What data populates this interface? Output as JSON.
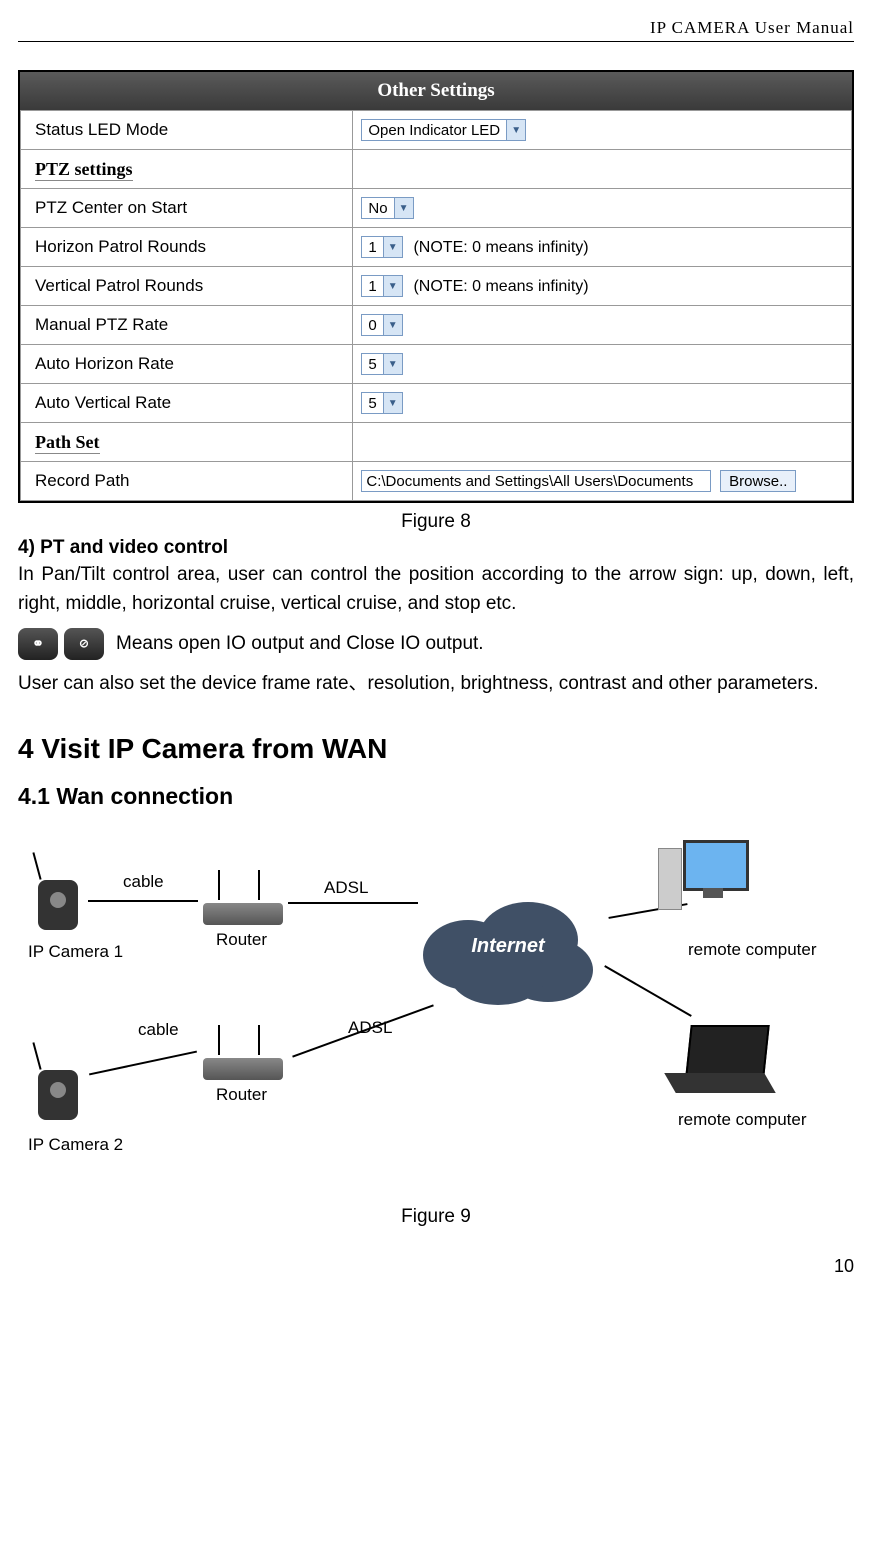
{
  "header": {
    "title": "IP CAMERA User Manual"
  },
  "settings": {
    "title": "Other Settings",
    "rows": {
      "status_led": {
        "label": "Status LED Mode",
        "value": "Open Indicator LED"
      },
      "ptz_heading": "PTZ settings",
      "ptz_center": {
        "label": "PTZ Center on Start",
        "value": "No"
      },
      "horizon_patrol": {
        "label": "Horizon Patrol Rounds",
        "value": "1",
        "note": "(NOTE: 0 means infinity)"
      },
      "vertical_patrol": {
        "label": "Vertical Patrol Rounds",
        "value": "1",
        "note": "(NOTE: 0 means infinity)"
      },
      "manual_ptz": {
        "label": "Manual PTZ Rate",
        "value": "0"
      },
      "auto_horizon": {
        "label": "Auto Horizon Rate",
        "value": "5"
      },
      "auto_vertical": {
        "label": "Auto Vertical Rate",
        "value": "5"
      },
      "path_heading": "Path Set",
      "record_path": {
        "label": "Record Path",
        "value": "C:\\Documents and Settings\\All Users\\Documents",
        "button": "Browse.."
      }
    }
  },
  "captions": {
    "fig8": "Figure 8",
    "fig9": "Figure 9"
  },
  "section4": {
    "title": "4)  PT and video control",
    "para1": "In Pan/Tilt control area, user can control the position according to the arrow sign: up, down, left, right, middle, horizontal cruise, vertical cruise, and stop etc.",
    "io_text": "Means open IO output and Close IO output.",
    "para2": "User can also set the device frame rate、resolution, brightness, contrast and other parameters."
  },
  "headings": {
    "h2": "4  Visit IP Camera from WAN",
    "h3": "4.1  Wan connection"
  },
  "diagram": {
    "cam1": "IP Camera 1",
    "cam2": "IP Camera  2",
    "cable": "cable",
    "router": "Router",
    "adsl": "ADSL",
    "internet": "Internet",
    "remote": "remote computer"
  },
  "page_num": "10"
}
